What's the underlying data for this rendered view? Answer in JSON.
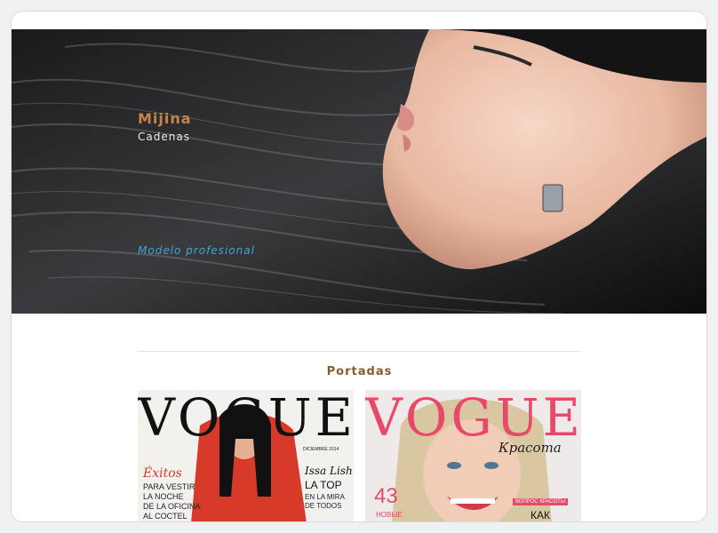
{
  "hero": {
    "name": "Mijina",
    "surname": "Cadenas",
    "tagline": "Modelo profesional"
  },
  "section": {
    "title": "Portadas"
  },
  "covers": [
    {
      "masthead": "VOGUE",
      "issue": "DICIEMBRE 2014",
      "headline_left": "Éxitos",
      "lines_left": [
        "PARA VESTIR",
        "LA NOCHE",
        "DE LA OFICINA",
        "AL COCTEL"
      ],
      "headline_right": "Issa Lish",
      "lines_right": [
        "LA TOP",
        "EN LA MIRA",
        "DE TODOS"
      ]
    },
    {
      "masthead": "VOGUE",
      "subtitle": "Красота",
      "number": "43",
      "line": "НОВЫЕ",
      "badge": "ВОПРОС КРАСОТЫ",
      "word": "КАК"
    }
  ],
  "colors": {
    "accent_name": "#c98345",
    "accent_tag": "#3fa7d6",
    "section_title": "#8a5a2b",
    "vogue_pink": "#e8486a"
  }
}
